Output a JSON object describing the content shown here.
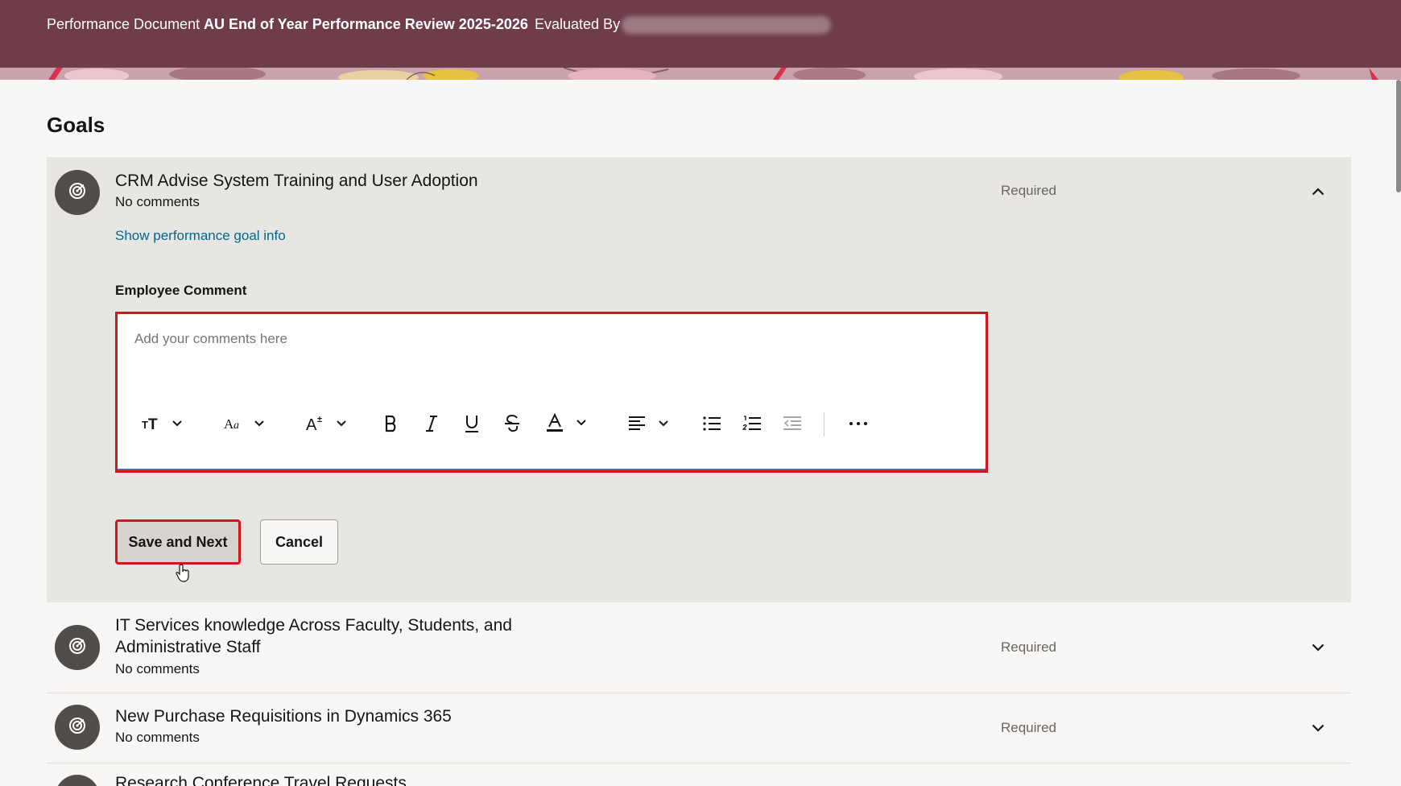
{
  "header": {
    "doc_label": "Performance Document",
    "doc_title": "AU End of Year Performance Review 2025-2026",
    "evaluated_label": "Evaluated By"
  },
  "section": {
    "title": "Goals"
  },
  "goals": [
    {
      "name": "CRM Advise System Training and User Adoption",
      "comments": "No comments",
      "status": "Required",
      "expanded": true,
      "info_link": "Show performance goal info",
      "comment_label": "Employee Comment",
      "comment_placeholder": "Add your comments here",
      "comment_value": ""
    },
    {
      "name": "IT Services knowledge Across Faculty, Students, and Administrative Staff",
      "comments": "No comments",
      "status": "Required",
      "expanded": false
    },
    {
      "name": "New Purchase Requisitions in Dynamics 365",
      "comments": "No comments",
      "status": "Required",
      "expanded": false
    },
    {
      "name": "Research Conference Travel Requests"
    }
  ],
  "toolbar": {
    "items": [
      "text-size-icon",
      "font-family-icon",
      "font-size-icon",
      "bold-icon",
      "italic-icon",
      "underline-icon",
      "strikethrough-icon",
      "font-color-icon",
      "align-icon",
      "bullet-list-icon",
      "numbered-list-icon",
      "outdent-icon",
      "more-icon"
    ]
  },
  "actions": {
    "save_label": "Save and Next",
    "cancel_label": "Cancel"
  },
  "colors": {
    "header_bg": "#6f3c4a",
    "link": "#00688c",
    "highlight": "#d2161e",
    "panel_bg": "#e8e6e3",
    "avatar_bg": "#524d48"
  }
}
